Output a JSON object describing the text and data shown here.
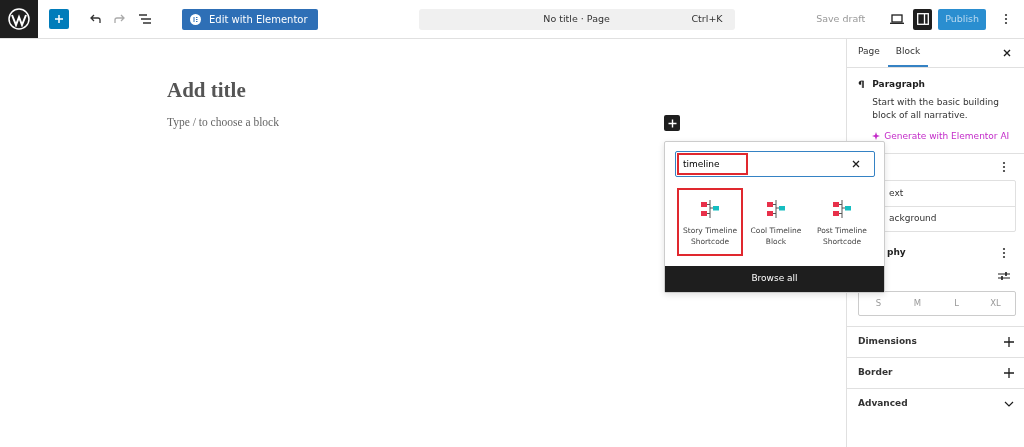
{
  "toolbar": {
    "elementor_button": "Edit with Elementor",
    "command_bar": {
      "title": "No title · Page",
      "shortcut": "Ctrl+K"
    },
    "save_draft": "Save draft",
    "settings_open": true,
    "publish": "Publish"
  },
  "editor": {
    "title_placeholder": "Add title",
    "block_placeholder": "Type / to choose a block"
  },
  "inserter": {
    "search": {
      "value": "timeline",
      "highlighted": true
    },
    "results": [
      {
        "label": "Story Timeline Shortcode",
        "selected": true
      },
      {
        "label": "Cool Timeline Block",
        "selected": false
      },
      {
        "label": "Post Timeline Shortcode",
        "selected": false
      }
    ],
    "browse_all": "Browse all"
  },
  "sidebar": {
    "tabs": [
      {
        "label": "Page",
        "selected": false
      },
      {
        "label": "Block",
        "selected": true
      }
    ],
    "block": {
      "name": "Paragraph",
      "description": "Start with the basic building block of all narrative.",
      "ai_link": "Generate with Elementor AI"
    },
    "color_items": [
      "ext",
      "ackground"
    ],
    "typography": {
      "title": "phy",
      "sizes": [
        {
          "label": "S",
          "selected": false
        },
        {
          "label": "M",
          "selected": false
        },
        {
          "label": "L",
          "selected": false
        },
        {
          "label": "XL",
          "selected": false
        }
      ]
    },
    "panels": [
      {
        "label": "Dimensions",
        "kind": "add"
      },
      {
        "label": "Border",
        "kind": "add"
      },
      {
        "label": "Advanced",
        "kind": "expand"
      }
    ]
  }
}
